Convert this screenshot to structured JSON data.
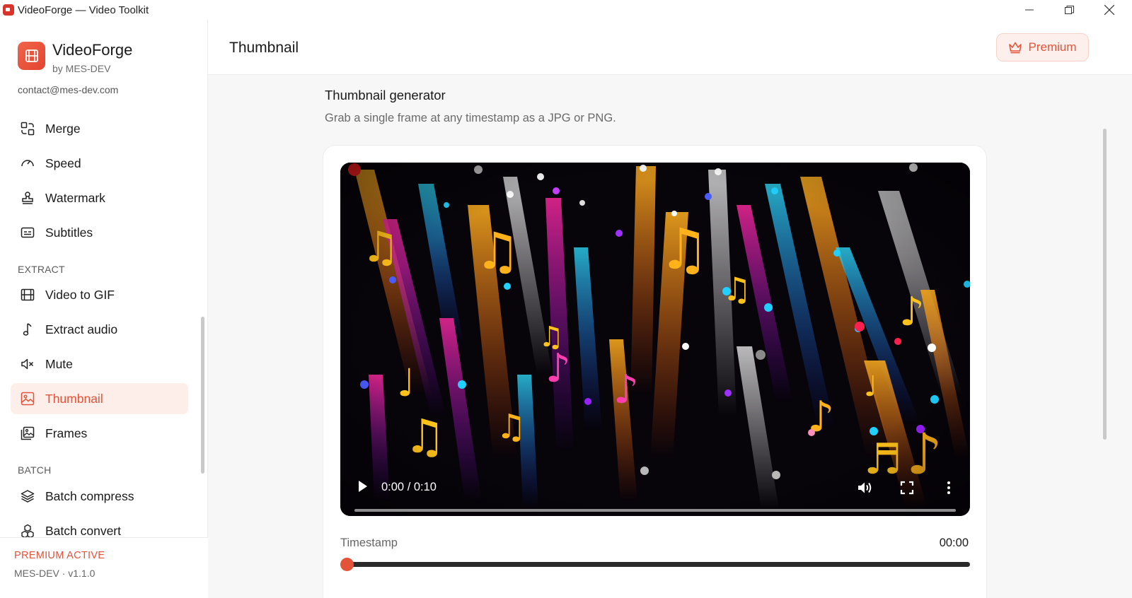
{
  "window": {
    "title": "VideoForge — Video Toolkit"
  },
  "brand": {
    "name": "VideoForge",
    "by": "by MES-DEV",
    "contact": "contact@mes-dev.com"
  },
  "sidebar": {
    "items": [
      {
        "label": "Merge",
        "icon": "merge-icon"
      },
      {
        "label": "Speed",
        "icon": "gauge-icon"
      },
      {
        "label": "Watermark",
        "icon": "stamp-icon"
      },
      {
        "label": "Subtitles",
        "icon": "subtitles-icon"
      }
    ],
    "extract_label": "EXTRACT",
    "extract_items": [
      {
        "label": "Video to GIF",
        "icon": "film-icon"
      },
      {
        "label": "Extract audio",
        "icon": "music-note-icon"
      },
      {
        "label": "Mute",
        "icon": "mute-icon"
      },
      {
        "label": "Thumbnail",
        "icon": "image-icon",
        "active": true
      },
      {
        "label": "Frames",
        "icon": "images-icon"
      }
    ],
    "batch_label": "BATCH",
    "batch_items": [
      {
        "label": "Batch compress",
        "icon": "layers-icon"
      },
      {
        "label": "Batch convert",
        "icon": "cubes-icon"
      }
    ],
    "footer": {
      "status": "PREMIUM ACTIVE",
      "version": "MES-DEV · v1.1.0"
    }
  },
  "header": {
    "title": "Thumbnail",
    "premium_label": "Premium"
  },
  "main": {
    "section_title": "Thumbnail generator",
    "section_subtitle": "Grab a single frame at any timestamp as a JPG or PNG.",
    "video": {
      "time": "0:00 / 0:10",
      "progress": 0
    },
    "timestamp_label": "Timestamp",
    "timestamp_value": "00:00",
    "timestamp_fraction": 0
  },
  "colors": {
    "accent": "#e3533a",
    "accent_bg": "#fdeee9",
    "content_bg": "#f7f7f8"
  }
}
